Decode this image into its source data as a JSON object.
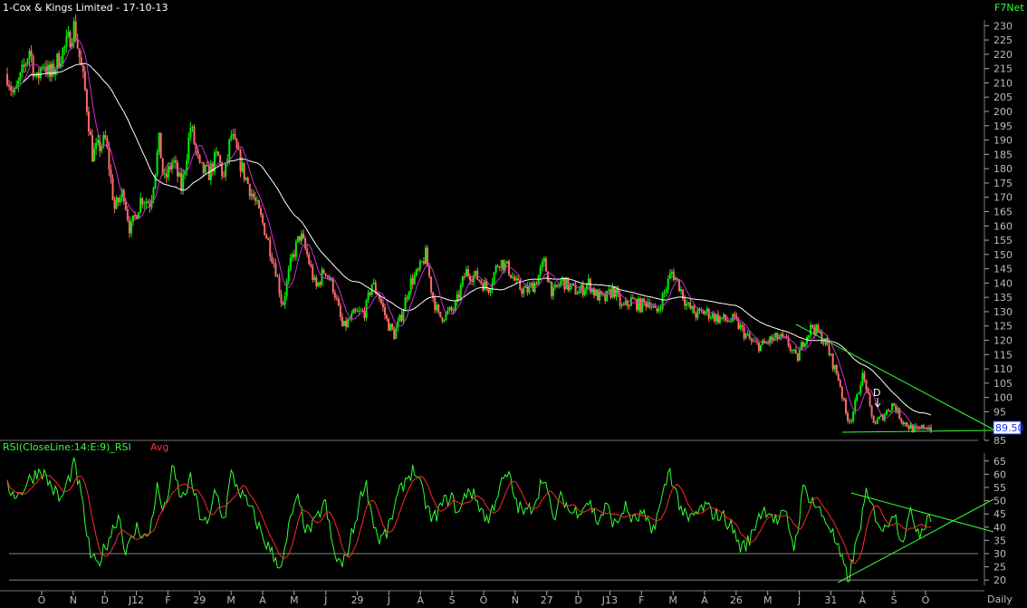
{
  "header": {
    "title": "1-Cox & Kings Limited - 17-10-13",
    "brand": "F7Net"
  },
  "colors": {
    "background": "#000000",
    "up_candle": "#00ee00",
    "down_candle": "#ff6a6a",
    "fast_ma": "#cc33cc",
    "slow_ma": "#ffffff",
    "trendline": "#33ff33",
    "rsi_line": "#33ff33",
    "rsi_avg": "#ff2a2a",
    "grid": "#7a7a7a",
    "price_box": "#2233ff"
  },
  "chart_data": [
    {
      "type": "candlestick",
      "ylim": [
        85,
        232
      ],
      "y_ticks": [
        85,
        95,
        100,
        105,
        110,
        115,
        120,
        125,
        130,
        135,
        140,
        145,
        150,
        155,
        160,
        165,
        170,
        175,
        180,
        185,
        190,
        195,
        200,
        205,
        210,
        215,
        220,
        225,
        230
      ],
      "last_price_label": "89.50",
      "last_price": 89.5,
      "annotation": "D",
      "close_path": [
        [
          0,
          213
        ],
        [
          0.03,
          205
        ],
        [
          0.07,
          214
        ],
        [
          0.1,
          222
        ],
        [
          0.13,
          210
        ],
        [
          0.16,
          218
        ],
        [
          0.19,
          212
        ],
        [
          0.24,
          220
        ],
        [
          0.27,
          224
        ],
        [
          0.3,
          230
        ],
        [
          0.35,
          206
        ],
        [
          0.38,
          185
        ],
        [
          0.44,
          190
        ],
        [
          0.48,
          166
        ],
        [
          0.52,
          172
        ],
        [
          0.55,
          158
        ],
        [
          0.6,
          170
        ],
        [
          0.64,
          168
        ],
        [
          0.68,
          190
        ],
        [
          0.7,
          175
        ],
        [
          0.74,
          183
        ],
        [
          0.78,
          173
        ],
        [
          0.82,
          195
        ],
        [
          0.86,
          180
        ],
        [
          0.9,
          178
        ],
        [
          0.94,
          185
        ],
        [
          0.97,
          176
        ],
        [
          1.0,
          192
        ],
        [
          1.05,
          180
        ],
        [
          1.1,
          170
        ],
        [
          1.15,
          159
        ],
        [
          1.2,
          145
        ],
        [
          1.23,
          132
        ],
        [
          1.27,
          148
        ],
        [
          1.31,
          157
        ],
        [
          1.34,
          150
        ],
        [
          1.38,
          138
        ],
        [
          1.42,
          145
        ],
        [
          1.46,
          138
        ],
        [
          1.5,
          124
        ],
        [
          1.55,
          129
        ],
        [
          1.6,
          130
        ],
        [
          1.63,
          140
        ],
        [
          1.66,
          136
        ],
        [
          1.7,
          126
        ],
        [
          1.73,
          122
        ],
        [
          1.76,
          128
        ],
        [
          1.8,
          140
        ],
        [
          1.84,
          144
        ],
        [
          1.87,
          150
        ],
        [
          1.9,
          136
        ],
        [
          1.93,
          128
        ],
        [
          1.96,
          129
        ],
        [
          2.0,
          131
        ],
        [
          2.05,
          144
        ],
        [
          2.1,
          142
        ],
        [
          2.15,
          138
        ],
        [
          2.2,
          148
        ],
        [
          2.24,
          145
        ],
        [
          2.28,
          139
        ],
        [
          2.32,
          137
        ],
        [
          2.36,
          140
        ],
        [
          2.4,
          147
        ],
        [
          2.44,
          136
        ],
        [
          2.48,
          141
        ],
        [
          2.52,
          138
        ],
        [
          2.56,
          137
        ],
        [
          2.6,
          140
        ],
        [
          2.63,
          136
        ],
        [
          2.67,
          134
        ],
        [
          2.71,
          138
        ],
        [
          2.75,
          131
        ],
        [
          2.79,
          134
        ],
        [
          2.83,
          132
        ],
        [
          2.87,
          134
        ],
        [
          2.9,
          129
        ],
        [
          2.94,
          137
        ],
        [
          2.97,
          144
        ],
        [
          3.0,
          140
        ],
        [
          3.04,
          132
        ],
        [
          3.08,
          129
        ],
        [
          3.12,
          130
        ],
        [
          3.17,
          128
        ],
        [
          3.21,
          127
        ],
        [
          3.25,
          127
        ],
        [
          3.29,
          123
        ],
        [
          3.33,
          119
        ],
        [
          3.37,
          118
        ],
        [
          3.41,
          120
        ],
        [
          3.45,
          121
        ],
        [
          3.49,
          119
        ],
        [
          3.53,
          113
        ],
        [
          3.56,
          120
        ],
        [
          3.6,
          125
        ],
        [
          3.63,
          122
        ],
        [
          3.66,
          119
        ],
        [
          3.69,
          112
        ],
        [
          3.72,
          106
        ],
        [
          3.75,
          94
        ],
        [
          3.77,
          92
        ],
        [
          3.8,
          100
        ],
        [
          3.82,
          108
        ],
        [
          3.84,
          104
        ],
        [
          3.86,
          94
        ],
        [
          3.88,
          91
        ],
        [
          3.92,
          94
        ],
        [
          3.96,
          98
        ],
        [
          4.0,
          92
        ],
        [
          4.03,
          90
        ],
        [
          4.07,
          88
        ],
        [
          4.1,
          90
        ],
        [
          4.13,
          89.5
        ]
      ],
      "x_labels": [
        "O",
        "N",
        "D",
        "J12",
        "F",
        "29",
        "M",
        "A",
        "M",
        "J",
        "29",
        "J",
        "A",
        "S",
        "O",
        "N",
        "27",
        "D",
        "J13",
        "F",
        "M",
        "A",
        "26",
        "M",
        "J",
        "31",
        "A",
        "S",
        "O"
      ],
      "x_period_label": "Daily"
    },
    {
      "type": "line",
      "title": "RSI(CloseLine:14:E:9)_RSI",
      "avg_label": "Avg",
      "ylim": [
        18,
        68
      ],
      "y_ticks": [
        20,
        25,
        30,
        35,
        40,
        45,
        50,
        55,
        60,
        65
      ],
      "reference_lines": [
        20,
        30
      ],
      "rsi_path": [
        [
          0,
          55
        ],
        [
          0.05,
          52
        ],
        [
          0.1,
          58
        ],
        [
          0.15,
          62
        ],
        [
          0.2,
          55
        ],
        [
          0.24,
          50
        ],
        [
          0.3,
          64
        ],
        [
          0.33,
          52
        ],
        [
          0.37,
          30
        ],
        [
          0.4,
          25
        ],
        [
          0.45,
          35
        ],
        [
          0.5,
          45
        ],
        [
          0.53,
          30
        ],
        [
          0.58,
          40
        ],
        [
          0.63,
          35
        ],
        [
          0.67,
          55
        ],
        [
          0.7,
          45
        ],
        [
          0.74,
          62
        ],
        [
          0.78,
          50
        ],
        [
          0.82,
          58
        ],
        [
          0.86,
          45
        ],
        [
          0.9,
          40
        ],
        [
          0.93,
          55
        ],
        [
          0.97,
          42
        ],
        [
          1.0,
          60
        ],
        [
          1.05,
          52
        ],
        [
          1.1,
          45
        ],
        [
          1.15,
          35
        ],
        [
          1.2,
          28
        ],
        [
          1.23,
          25
        ],
        [
          1.27,
          45
        ],
        [
          1.3,
          50
        ],
        [
          1.34,
          38
        ],
        [
          1.38,
          42
        ],
        [
          1.42,
          50
        ],
        [
          1.46,
          30
        ],
        [
          1.5,
          25
        ],
        [
          1.55,
          40
        ],
        [
          1.6,
          58
        ],
        [
          1.63,
          45
        ],
        [
          1.66,
          35
        ],
        [
          1.7,
          38
        ],
        [
          1.74,
          50
        ],
        [
          1.78,
          58
        ],
        [
          1.82,
          62
        ],
        [
          1.86,
          52
        ],
        [
          1.9,
          42
        ],
        [
          1.94,
          48
        ],
        [
          1.98,
          52
        ],
        [
          2.02,
          45
        ],
        [
          2.06,
          55
        ],
        [
          2.1,
          50
        ],
        [
          2.15,
          42
        ],
        [
          2.2,
          55
        ],
        [
          2.24,
          60
        ],
        [
          2.28,
          48
        ],
        [
          2.32,
          45
        ],
        [
          2.36,
          50
        ],
        [
          2.4,
          60
        ],
        [
          2.44,
          42
        ],
        [
          2.48,
          52
        ],
        [
          2.52,
          45
        ],
        [
          2.56,
          47
        ],
        [
          2.6,
          50
        ],
        [
          2.64,
          42
        ],
        [
          2.68,
          48
        ],
        [
          2.72,
          40
        ],
        [
          2.76,
          48
        ],
        [
          2.8,
          42
        ],
        [
          2.84,
          45
        ],
        [
          2.88,
          38
        ],
        [
          2.92,
          48
        ],
        [
          2.96,
          62
        ],
        [
          3.0,
          50
        ],
        [
          3.04,
          42
        ],
        [
          3.08,
          45
        ],
        [
          3.12,
          48
        ],
        [
          3.16,
          45
        ],
        [
          3.2,
          44
        ],
        [
          3.24,
          40
        ],
        [
          3.28,
          32
        ],
        [
          3.32,
          35
        ],
        [
          3.36,
          45
        ],
        [
          3.4,
          47
        ],
        [
          3.44,
          42
        ],
        [
          3.48,
          45
        ],
        [
          3.52,
          32
        ],
        [
          3.56,
          55
        ],
        [
          3.6,
          50
        ],
        [
          3.64,
          45
        ],
        [
          3.68,
          40
        ],
        [
          3.72,
          30
        ],
        [
          3.76,
          20
        ],
        [
          3.8,
          35
        ],
        [
          3.84,
          52
        ],
        [
          3.88,
          45
        ],
        [
          3.92,
          38
        ],
        [
          3.96,
          47
        ],
        [
          4.0,
          35
        ],
        [
          4.04,
          45
        ],
        [
          4.08,
          38
        ],
        [
          4.12,
          45
        ],
        [
          4.14,
          42
        ]
      ],
      "avg_path": [
        [
          0,
          52
        ],
        [
          0.2,
          56
        ],
        [
          0.4,
          35
        ],
        [
          0.6,
          42
        ],
        [
          0.8,
          52
        ],
        [
          1.0,
          50
        ],
        [
          1.2,
          38
        ],
        [
          1.4,
          42
        ],
        [
          1.6,
          45
        ],
        [
          1.8,
          50
        ],
        [
          2.0,
          48
        ],
        [
          2.2,
          50
        ],
        [
          2.4,
          52
        ],
        [
          2.6,
          48
        ],
        [
          2.8,
          46
        ],
        [
          3.0,
          48
        ],
        [
          3.2,
          45
        ],
        [
          3.4,
          44
        ],
        [
          3.6,
          46
        ],
        [
          3.76,
          30
        ],
        [
          3.9,
          42
        ],
        [
          4.14,
          44
        ]
      ]
    }
  ]
}
